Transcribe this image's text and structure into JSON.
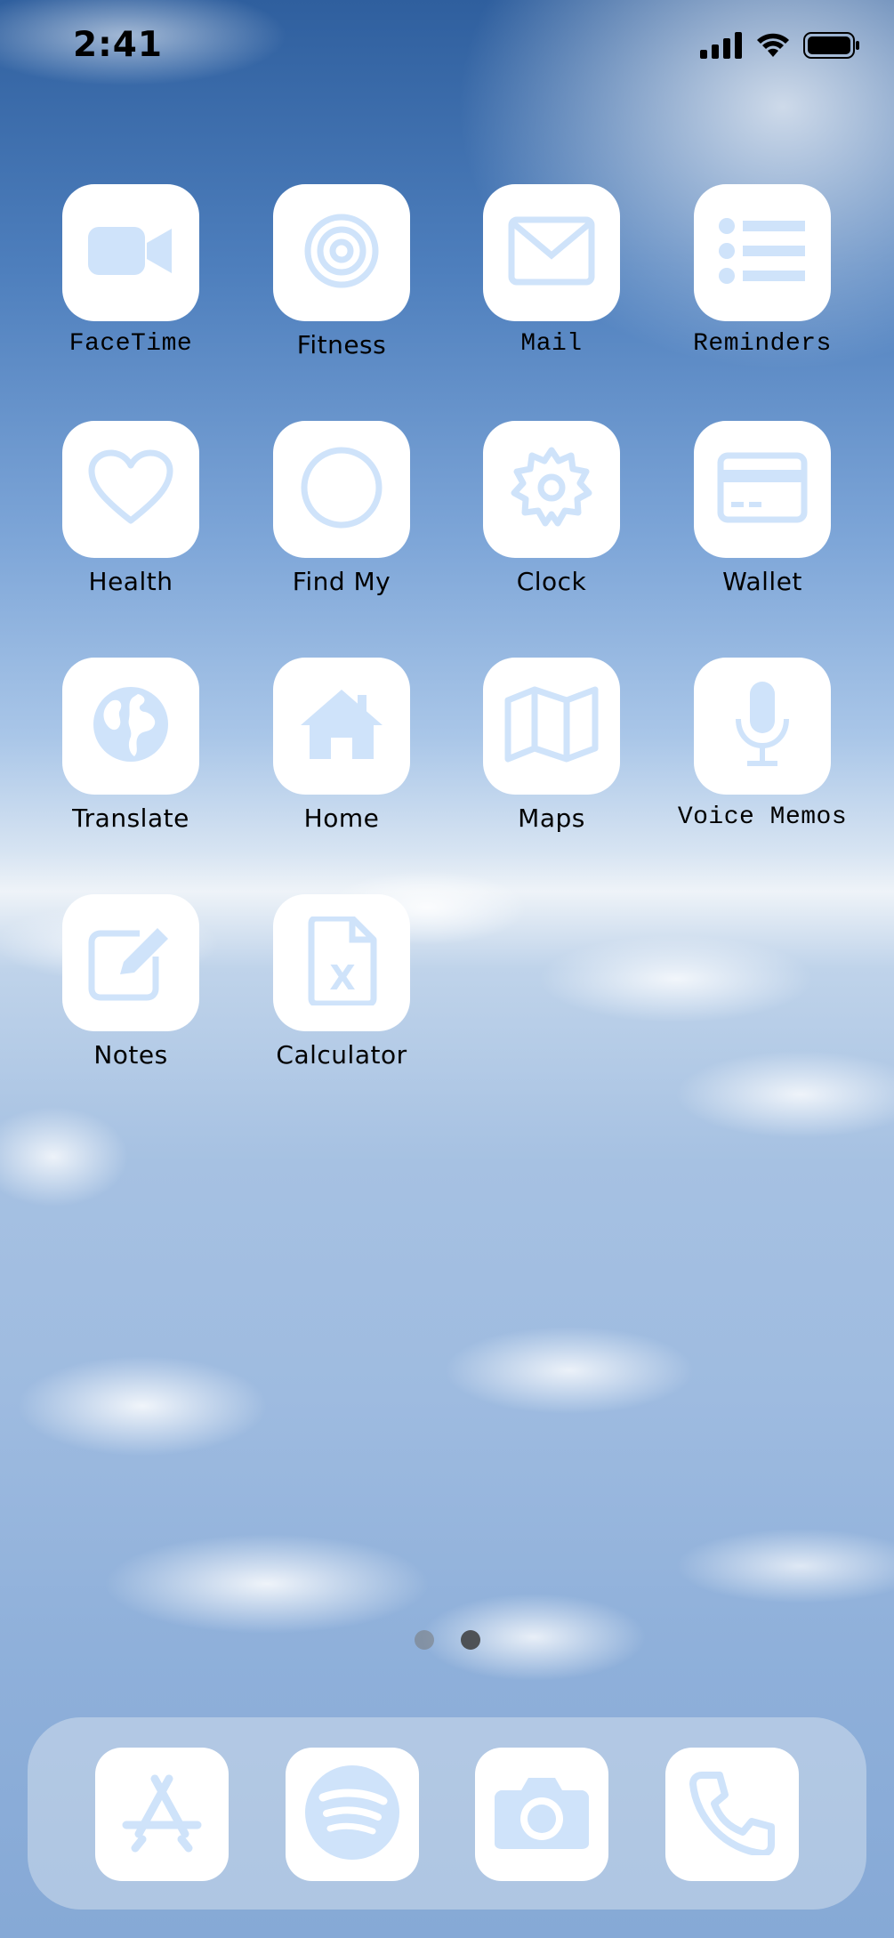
{
  "status_bar": {
    "time": "2:41",
    "icons": [
      "cellular-signal-icon",
      "wifi-icon",
      "battery-icon"
    ]
  },
  "colors": {
    "icon_tint": "#cfe3fa",
    "tile_background": "#ffffff",
    "label": "#000000"
  },
  "apps": [
    {
      "label": "FaceTime",
      "icon": "video-camera-icon"
    },
    {
      "label": "Fitness",
      "icon": "target-rings-icon"
    },
    {
      "label": "Mail",
      "icon": "envelope-icon"
    },
    {
      "label": "Reminders",
      "icon": "list-icon"
    },
    {
      "label": "Health",
      "icon": "heart-icon"
    },
    {
      "label": "Find My",
      "icon": "circle-icon"
    },
    {
      "label": "Clock",
      "icon": "gear-icon"
    },
    {
      "label": "Wallet",
      "icon": "credit-card-icon"
    },
    {
      "label": "Translate",
      "icon": "globe-icon"
    },
    {
      "label": "Home",
      "icon": "house-icon"
    },
    {
      "label": "Maps",
      "icon": "map-icon"
    },
    {
      "label": "Voice Memos",
      "icon": "microphone-icon"
    },
    {
      "label": "Notes",
      "icon": "pencil-square-icon"
    },
    {
      "label": "Calculator",
      "icon": "excel-file-icon"
    }
  ],
  "page_indicator": {
    "pages": 2,
    "current": 2
  },
  "dock": [
    {
      "name": "App Store",
      "icon": "app-store-icon"
    },
    {
      "name": "Spotify",
      "icon": "spotify-icon"
    },
    {
      "name": "Camera",
      "icon": "camera-icon"
    },
    {
      "name": "Phone",
      "icon": "phone-icon"
    }
  ]
}
